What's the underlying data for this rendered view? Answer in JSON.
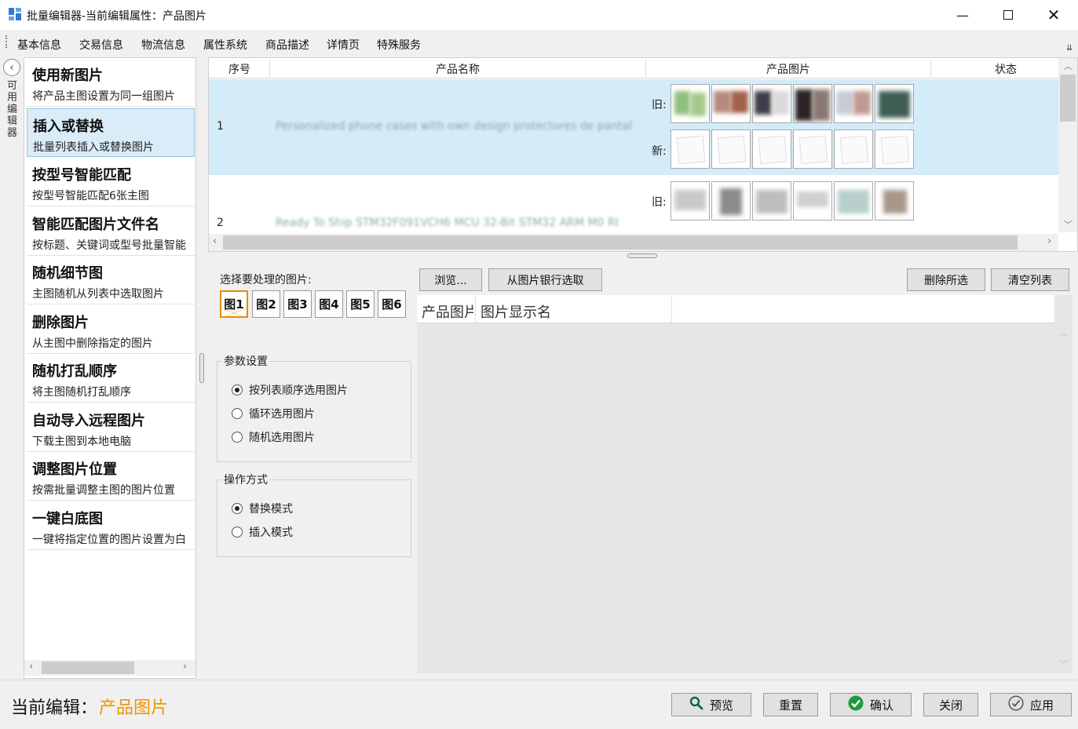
{
  "window": {
    "title": "批量编辑器-当前编辑属性：产品图片",
    "controls": [
      "minimize",
      "maximize",
      "close"
    ]
  },
  "menu": {
    "items": [
      "基本信息",
      "交易信息",
      "物流信息",
      "属性系统",
      "商品描述",
      "详情页",
      "特殊服务"
    ],
    "overflow": "⇊"
  },
  "side_tab": {
    "label": "可用编辑器"
  },
  "sidebar": {
    "items": [
      {
        "title": "使用新图片",
        "desc": "将产品主图设置为同一组图片"
      },
      {
        "title": "插入或替换",
        "desc": "批量列表插入或替换图片"
      },
      {
        "title": "按型号智能匹配",
        "desc": "按型号智能匹配6张主图"
      },
      {
        "title": "智能匹配图片文件名",
        "desc": "按标题、关键词或型号批量智能"
      },
      {
        "title": "随机细节图",
        "desc": "主图随机从列表中选取图片"
      },
      {
        "title": "删除图片",
        "desc": "从主图中删除指定的图片"
      },
      {
        "title": "随机打乱顺序",
        "desc": "将主图随机打乱顺序"
      },
      {
        "title": "自动导入远程图片",
        "desc": "下载主图到本地电脑"
      },
      {
        "title": "调整图片位置",
        "desc": "按需批量调整主图的图片位置"
      },
      {
        "title": "一键白底图",
        "desc": "一键将指定位置的图片设置为白"
      }
    ],
    "selected_index": 1
  },
  "grid": {
    "columns": [
      "序号",
      "产品名称",
      "产品图片",
      "状态"
    ],
    "rows": [
      {
        "num": "1",
        "name": "Personalized phone cases with own design protectores de pantal",
        "old_label": "旧:",
        "new_label": "新:"
      },
      {
        "num": "2",
        "name": "Ready To Ship STM32F091VCH6 MCU 32-Bit STM32 ARM M0 RI",
        "old_label": "旧:"
      }
    ]
  },
  "lower": {
    "select_label": "选择要处理的图片:",
    "image_tabs": [
      "图1",
      "图2",
      "图3",
      "图4",
      "图5",
      "图6"
    ],
    "active_tab": 0,
    "params": {
      "legend": "参数设置",
      "options": [
        "按列表顺序选用图片",
        "循环选用图片",
        "随机选用图片"
      ],
      "selected": 0
    },
    "mode": {
      "legend": "操作方式",
      "options": [
        "替换模式",
        "插入模式"
      ],
      "selected": 0
    },
    "buttons": {
      "browse": "浏览...",
      "from_bank": "从图片银行选取",
      "delete_selected": "删除所选",
      "clear_list": "清空列表"
    },
    "file_table": {
      "columns": [
        "产品图片",
        "图片显示名"
      ]
    }
  },
  "status": {
    "current_label": "当前编辑：",
    "current_value": "产品图片",
    "accent": "#f39300"
  },
  "footer_buttons": {
    "preview": "预览",
    "reset": "重置",
    "confirm": "确认",
    "close": "关闭",
    "apply": "应用"
  },
  "icons": {
    "preview": "search-icon",
    "confirm": "check-circle-icon",
    "apply": "check-outline-icon"
  }
}
